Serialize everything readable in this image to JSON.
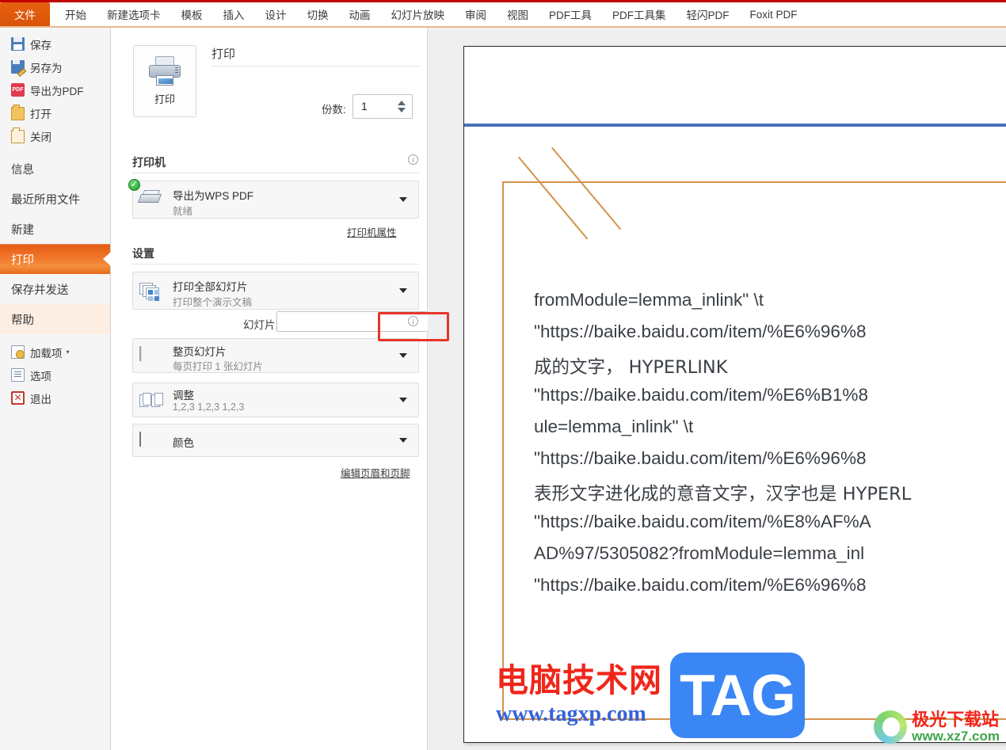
{
  "ribbon": {
    "tabs": [
      {
        "label": "文件",
        "active": true
      },
      {
        "label": "开始",
        "active": false
      },
      {
        "label": "新建选项卡",
        "active": false
      },
      {
        "label": "模板",
        "active": false
      },
      {
        "label": "插入",
        "active": false
      },
      {
        "label": "设计",
        "active": false
      },
      {
        "label": "切换",
        "active": false
      },
      {
        "label": "动画",
        "active": false
      },
      {
        "label": "幻灯片放映",
        "active": false
      },
      {
        "label": "审阅",
        "active": false
      },
      {
        "label": "视图",
        "active": false
      },
      {
        "label": "PDF工具",
        "active": false
      },
      {
        "label": "PDF工具集",
        "active": false
      },
      {
        "label": "轻闪PDF",
        "active": false
      },
      {
        "label": "Foxit PDF",
        "active": false
      }
    ]
  },
  "sidebar": {
    "items": [
      {
        "label": "保存",
        "icon": "floppy-disk-icon"
      },
      {
        "label": "另存为",
        "icon": "save-as-icon"
      },
      {
        "label": "导出为PDF",
        "icon": "export-pdf-icon"
      },
      {
        "label": "打开",
        "icon": "open-folder-icon"
      },
      {
        "label": "关闭",
        "icon": "close-folder-icon"
      },
      {
        "label": "信息",
        "icon": ""
      },
      {
        "label": "最近所用文件",
        "icon": ""
      },
      {
        "label": "新建",
        "icon": ""
      },
      {
        "label": "打印",
        "icon": ""
      },
      {
        "label": "保存并发送",
        "icon": ""
      },
      {
        "label": "帮助",
        "icon": ""
      },
      {
        "label": "加载项",
        "icon": "addins-icon"
      },
      {
        "label": "选项",
        "icon": "options-icon"
      },
      {
        "label": "退出",
        "icon": "exit-icon"
      }
    ],
    "addins_caret": "▾",
    "active_item": "打印",
    "highlighted_item": "帮助"
  },
  "print_panel": {
    "print_button_label": "打印",
    "print_heading": "打印",
    "copies_label": "份数:",
    "copies_value": "1",
    "printer_section_title": "打印机",
    "printer": {
      "name": "导出为WPS PDF",
      "status": "就绪"
    },
    "printer_properties_link": "打印机属性",
    "settings_section_title": "设置",
    "range": {
      "title": "打印全部幻灯片",
      "subtitle": "打印整个演示文稿"
    },
    "slides_label": "幻灯片:",
    "slides_value": "",
    "layout": {
      "title": "整页幻灯片",
      "subtitle": "每页打印 1 张幻灯片"
    },
    "collate": {
      "title": "调整",
      "subtitle": "1,2,3   1,2,3   1,2,3"
    },
    "color": {
      "title": "颜色",
      "subtitle": ""
    },
    "header_footer_link": "编辑页眉和页脚",
    "info_icons": [
      "info-icon",
      "info-icon"
    ]
  },
  "annotation": {
    "highlight_color": "#e8352a",
    "target": "layout-dropdown-caret"
  },
  "preview": {
    "document_lines": [
      "fromModule=lemma_inlink\" \\t",
      "\"https://baike.baidu.com/item/%E6%96%8",
      "成的文字， HYPERLINK",
      "\"https://baike.baidu.com/item/%E6%B1%8",
      "ule=lemma_inlink\" \\t",
      "\"https://baike.baidu.com/item/%E6%96%8",
      "表形文字进化成的意音文字，汉字也是 HYPERL",
      "\"https://baike.baidu.com/item/%E8%AF%A",
      "AD%97/5305082?fromModule=lemma_inl",
      "\"https://baike.baidu.com/item/%E6%96%8"
    ],
    "accent_colors": {
      "rule": "#4a72b8",
      "frame": "#d2934a"
    }
  },
  "watermarks": {
    "main_cn": "电脑技术网",
    "main_url": "www.tagxp.com",
    "badge": "TAG",
    "corner_cn": "极光下载站",
    "corner_url": "www.xz7.com"
  }
}
